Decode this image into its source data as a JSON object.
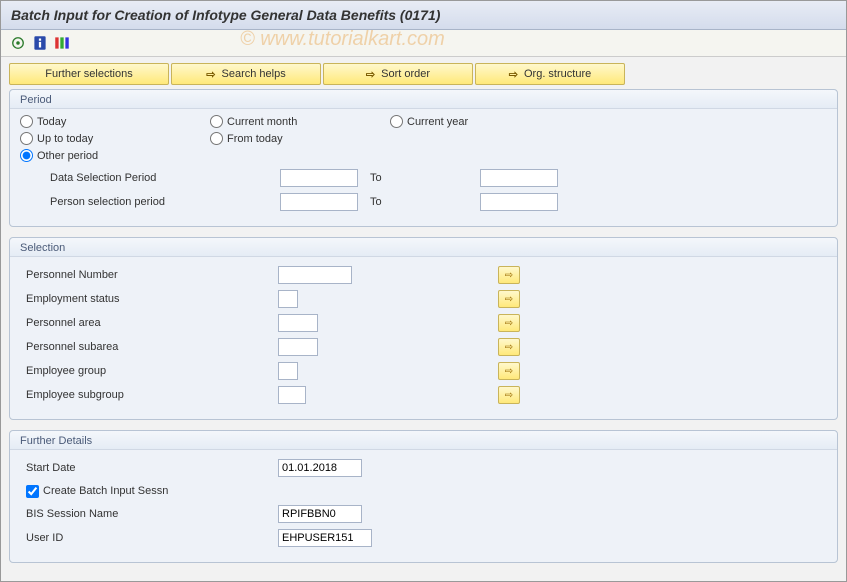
{
  "title": "Batch Input for Creation of Infotype General Data Benefits (0171)",
  "watermark": "© www.tutorialkart.com",
  "toolbar_buttons": {
    "further_selections": "Further selections",
    "search_helps": "Search helps",
    "sort_order": "Sort order",
    "org_structure": "Org. structure"
  },
  "period": {
    "title": "Period",
    "radios": {
      "today": "Today",
      "current_month": "Current month",
      "current_year": "Current year",
      "up_to_today": "Up to today",
      "from_today": "From today",
      "other_period": "Other period"
    },
    "data_selection_label": "Data Selection Period",
    "person_selection_label": "Person selection period",
    "to_label": "To",
    "data_from": "",
    "data_to": "",
    "person_from": "",
    "person_to": ""
  },
  "selection": {
    "title": "Selection",
    "personnel_number": {
      "label": "Personnel Number",
      "value": ""
    },
    "employment_status": {
      "label": "Employment status",
      "value": ""
    },
    "personnel_area": {
      "label": "Personnel area",
      "value": ""
    },
    "personnel_subarea": {
      "label": "Personnel subarea",
      "value": ""
    },
    "employee_group": {
      "label": "Employee group",
      "value": ""
    },
    "employee_subgroup": {
      "label": "Employee subgroup",
      "value": ""
    }
  },
  "further": {
    "title": "Further Details",
    "start_date": {
      "label": "Start Date",
      "value": "01.01.2018"
    },
    "create_bis": {
      "label": "Create Batch Input Sessn",
      "checked": true
    },
    "bis_name": {
      "label": "BIS Session Name",
      "value": "RPIFBBN0"
    },
    "user_id": {
      "label": "User ID",
      "value": "EHPUSER151"
    }
  }
}
